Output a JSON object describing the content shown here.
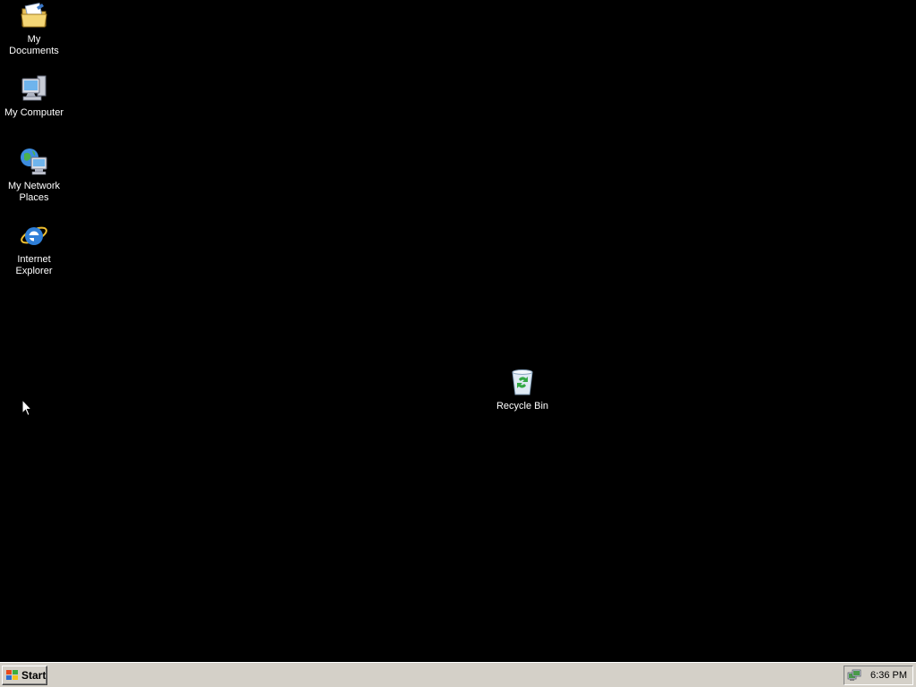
{
  "desktop": {
    "background": "#000000",
    "icons": [
      {
        "label": "My Documents",
        "icon": "folder-documents-icon"
      },
      {
        "label": "My Computer",
        "icon": "computer-icon"
      },
      {
        "label": "My Network\nPlaces",
        "icon": "network-places-icon"
      },
      {
        "label": "Internet\nExplorer",
        "icon": "internet-explorer-icon"
      },
      {
        "label": "Recycle Bin",
        "icon": "recycle-bin-icon"
      }
    ]
  },
  "taskbar": {
    "background": "#d4d0c8",
    "start_label": "Start",
    "clock": "6:36 PM",
    "tray_icon": "network-connection-icon"
  }
}
